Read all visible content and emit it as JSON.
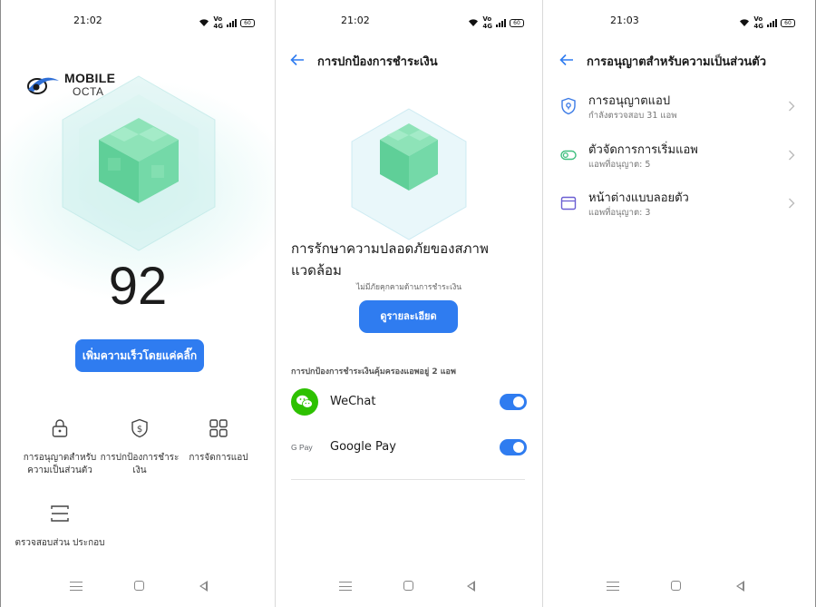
{
  "screens": [
    {
      "status_time": "21:02",
      "battery": "60",
      "logo": {
        "line1": "MOBILE",
        "line2": "OCTA"
      },
      "score": "92",
      "boost_button": "เพิ่มความเร็วโดยแค่คลิ๊ก",
      "tools": [
        {
          "label": "การอนุญาตสำหรับ ความเป็นส่วนตัว",
          "icon": "lock-icon"
        },
        {
          "label": "การปกป้องการชำระ เงิน",
          "icon": "dollar-shield-icon"
        },
        {
          "label": "การจัดการแอป",
          "icon": "app-grid-icon"
        },
        {
          "label": "ตรวจสอบส่วน ประกอบ",
          "icon": "scan-icon"
        }
      ]
    },
    {
      "status_time": "21:02",
      "battery": "60",
      "title": "การปกป้องการชำระเงิน",
      "safe_text": "การรักษาความปลอดภัยของสภาพ แวดล้อม",
      "safe_sub": "ไม่มีภัยคุกคามด้านการชำระเงิน",
      "detail_button": "ดูรายละเอียด",
      "section_label": "การปกป้องการชำระเงินคุ้มครองแอพอยู่ 2 แอพ",
      "apps": [
        {
          "name": "WeChat",
          "icon": "wechat-icon",
          "enabled": true
        },
        {
          "name": "Google Pay",
          "icon": "google-pay-icon",
          "icon_text": "G Pay",
          "enabled": true
        }
      ]
    },
    {
      "status_time": "21:03",
      "battery": "60",
      "title": "การอนุญาตสำหรับความเป็นส่วนตัว",
      "items": [
        {
          "title": "การอนุญาตแอป",
          "subtitle": "กำลังตรวจสอบ 31 แอพ",
          "icon": "shield-location-icon"
        },
        {
          "title": "ตัวจัดการการเริ่มแอพ",
          "subtitle": "แอพที่อนุญาต: 5",
          "icon": "toggle-icon"
        },
        {
          "title": "หน้าต่างแบบลอยตัว",
          "subtitle": "แอพที่อนุญาต: 3",
          "icon": "window-icon"
        }
      ]
    }
  ],
  "colors": {
    "accent": "#2f7cf0",
    "cube": "#6fd6a2",
    "wechat": "#2dc100",
    "icon_blue": "#3c7be6",
    "icon_green": "#3fbf7f",
    "icon_purple": "#6b5fd3"
  }
}
